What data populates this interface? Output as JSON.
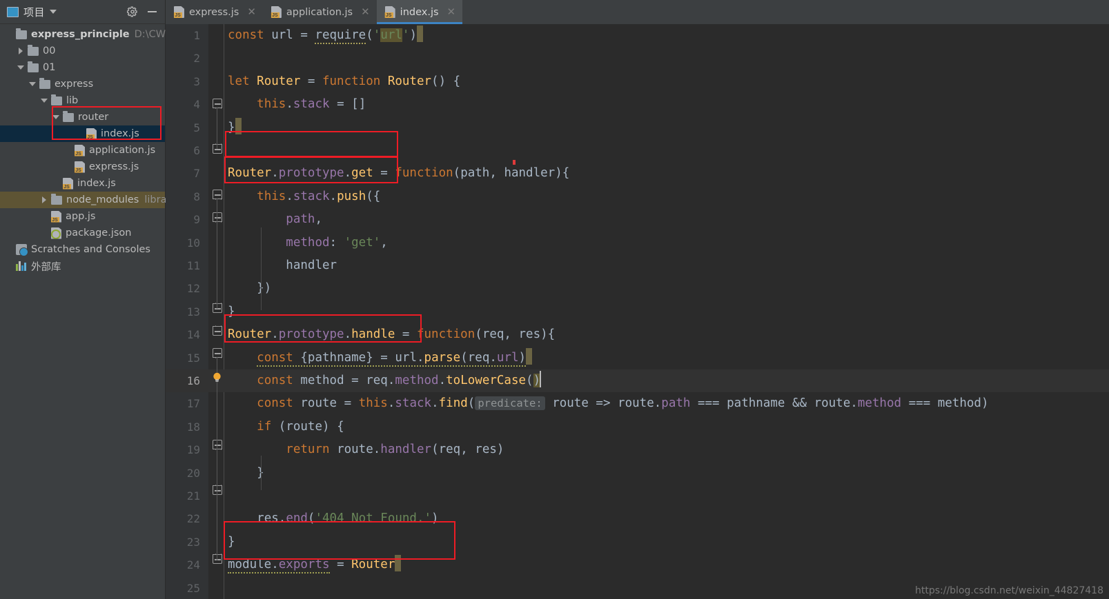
{
  "sidebar": {
    "header": {
      "title": "项目",
      "icon": "project-panel-icon",
      "settings_icon": "gear-icon",
      "minimize_icon": "minimize-icon"
    },
    "items": [
      {
        "label": "express_principle",
        "suffix": "D:\\CWork",
        "type": "folder",
        "arrow": "none",
        "depth": 0,
        "bold": true
      },
      {
        "label": "00",
        "suffix": "",
        "type": "folder",
        "arrow": "r",
        "depth": 1
      },
      {
        "label": "01",
        "suffix": "",
        "type": "folder",
        "arrow": "d",
        "depth": 1
      },
      {
        "label": "express",
        "suffix": "",
        "type": "folder",
        "arrow": "d",
        "depth": 2
      },
      {
        "label": "lib",
        "suffix": "",
        "type": "folder",
        "arrow": "d",
        "depth": 3
      },
      {
        "label": "router",
        "suffix": "",
        "type": "folder",
        "arrow": "d",
        "depth": 4
      },
      {
        "label": "index.js",
        "suffix": "",
        "type": "js",
        "arrow": "none",
        "depth": 6,
        "selected": true
      },
      {
        "label": "application.js",
        "suffix": "",
        "type": "js",
        "arrow": "none",
        "depth": 5
      },
      {
        "label": "express.js",
        "suffix": "",
        "type": "js",
        "arrow": "none",
        "depth": 5
      },
      {
        "label": "index.js",
        "suffix": "",
        "type": "js",
        "arrow": "none",
        "depth": 4
      },
      {
        "label": "node_modules",
        "suffix": "library",
        "type": "folder",
        "arrow": "r",
        "depth": 3,
        "library": true
      },
      {
        "label": "app.js",
        "suffix": "",
        "type": "js",
        "arrow": "none",
        "depth": 3
      },
      {
        "label": "package.json",
        "suffix": "",
        "type": "json",
        "arrow": "none",
        "depth": 3
      },
      {
        "label": "Scratches and Consoles",
        "suffix": "",
        "type": "scratch",
        "arrow": "none",
        "depth": 0
      },
      {
        "label": "外部库",
        "suffix": "",
        "type": "bars",
        "arrow": "none",
        "depth": 0
      }
    ]
  },
  "tabs": [
    {
      "label": "express.js",
      "icon": "js-file-icon",
      "close_icon": "close-icon",
      "active": false
    },
    {
      "label": "application.js",
      "icon": "js-file-icon",
      "close_icon": "close-icon",
      "active": false
    },
    {
      "label": "index.js",
      "icon": "js-file-icon",
      "close_icon": "close-icon",
      "active": true
    }
  ],
  "editor": {
    "current_line": 16,
    "caret_line_bulb_icon": "intention-bulb-icon",
    "lines": [
      {
        "n": 1,
        "text": "const url = require('url')"
      },
      {
        "n": 2,
        "text": ""
      },
      {
        "n": 3,
        "text": "let Router = function Router() {"
      },
      {
        "n": 4,
        "text": "    this.stack = []"
      },
      {
        "n": 5,
        "text": "}"
      },
      {
        "n": 6,
        "text": ""
      },
      {
        "n": 7,
        "text": "Router.prototype.get = function(path, handler){"
      },
      {
        "n": 8,
        "text": "    this.stack.push({"
      },
      {
        "n": 9,
        "text": "        path,"
      },
      {
        "n": 10,
        "text": "        method: 'get',"
      },
      {
        "n": 11,
        "text": "        handler"
      },
      {
        "n": 12,
        "text": "    })"
      },
      {
        "n": 13,
        "text": "}"
      },
      {
        "n": 14,
        "text": "Router.prototype.handle = function(req, res){"
      },
      {
        "n": 15,
        "text": "    const {pathname} = url.parse(req.url)"
      },
      {
        "n": 16,
        "text": "    const method = req.method.toLowerCase()"
      },
      {
        "n": 17,
        "text": "    const route = this.stack.find( predicate: route => route.path === pathname && route.method === method)"
      },
      {
        "n": 18,
        "text": "    if (route) {"
      },
      {
        "n": 19,
        "text": "        return route.handler(req, res)"
      },
      {
        "n": 20,
        "text": "    }"
      },
      {
        "n": 21,
        "text": ""
      },
      {
        "n": 22,
        "text": "    res.end('404 Not Found.')"
      },
      {
        "n": 23,
        "text": "}"
      },
      {
        "n": 24,
        "text": "module.exports = Router"
      },
      {
        "n": 25,
        "text": ""
      }
    ],
    "inlay_hint": "predicate:"
  },
  "annotations": {
    "color": "#ee1c25",
    "boxes": [
      {
        "name": "annot-router-folder",
        "target": "router"
      },
      {
        "name": "annot-this-stack",
        "target": "this.stack = []"
      },
      {
        "name": "annot-router-prototype-get",
        "target": "Router.prototype.get"
      },
      {
        "name": "annot-router-prototype-handle",
        "target": "Router.prototype.handle"
      },
      {
        "name": "annot-module-exports",
        "target": "module.exports = Router"
      }
    ]
  },
  "watermark": {
    "text": "https://blog.csdn.net/weixin_44827418"
  },
  "colors": {
    "editor_bg": "#2b2b2b",
    "gutter_bg": "#313335",
    "panel_bg": "#3c3f41",
    "selection_bg": "#0d293e",
    "library_bg": "#5e5434",
    "accent": "#3d84c4",
    "keyword": "#cc7832",
    "function": "#ffc66d",
    "property": "#9876aa",
    "string": "#6a8759",
    "plain": "#a9b7c6"
  }
}
